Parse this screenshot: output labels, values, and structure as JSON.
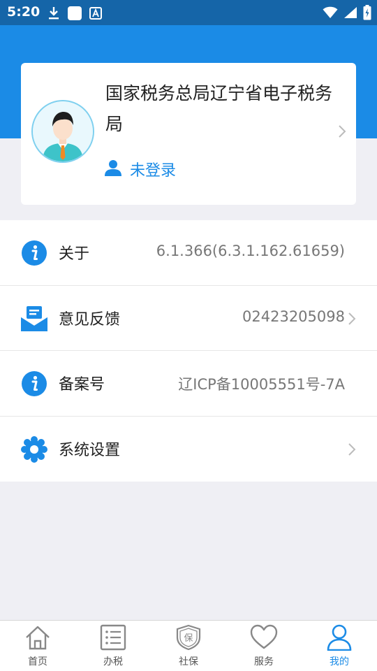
{
  "status_bar": {
    "time": "5:20",
    "icons": [
      "download-icon",
      "app-square-icon",
      "font-a-icon",
      "wifi-icon",
      "signal-icon",
      "battery-charging-icon"
    ]
  },
  "profile": {
    "name": "国家税务总局辽宁省电子税务局",
    "login_status": "未登录",
    "avatar_icon": "user-avatar-icon"
  },
  "menu": [
    {
      "icon": "info-icon",
      "label": "关于",
      "value": "6.1.366(6.3.1.162.61659)",
      "chevron": false
    },
    {
      "icon": "feedback-mail-icon",
      "label": "意见反馈",
      "value": "02423205098",
      "chevron": true
    },
    {
      "icon": "info-icon",
      "label": "备案号",
      "value": "辽ICP备10005551号-7A",
      "chevron": false
    },
    {
      "icon": "gear-icon",
      "label": "系统设置",
      "value": "",
      "chevron": true
    }
  ],
  "tabs": [
    {
      "icon": "home-icon",
      "label": "首页",
      "active": false
    },
    {
      "icon": "list-icon",
      "label": "办税",
      "active": false
    },
    {
      "icon": "shield-icon",
      "label": "社保",
      "active": false
    },
    {
      "icon": "heart-icon",
      "label": "服务",
      "active": false
    },
    {
      "icon": "person-icon",
      "label": "我的",
      "active": true
    }
  ],
  "colors": {
    "status_bar": "#1565a8",
    "header": "#1b8be6",
    "accent": "#1b8be6",
    "background": "#efeff4"
  }
}
